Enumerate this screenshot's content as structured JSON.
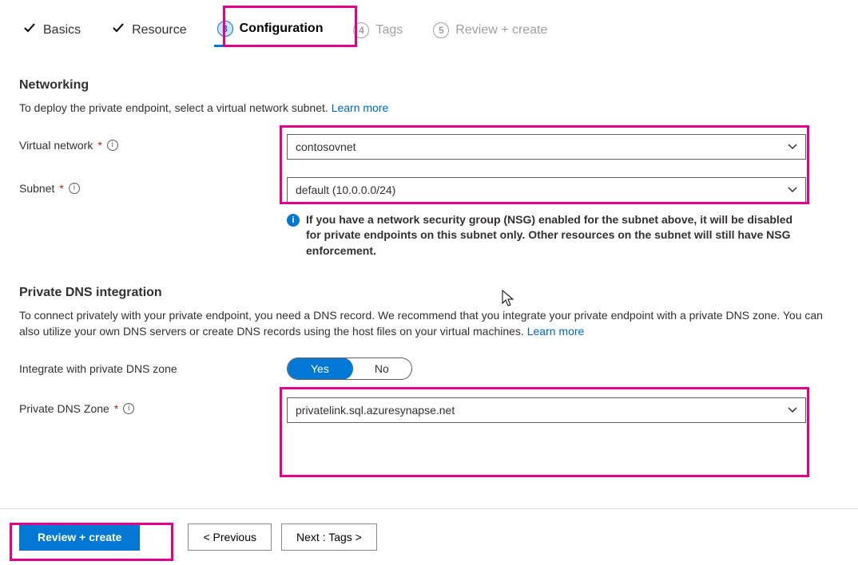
{
  "tabs": {
    "basics": "Basics",
    "resource": "Resource",
    "configuration_num": "3",
    "configuration": "Configuration",
    "tags_num": "4",
    "tags": "Tags",
    "review_num": "5",
    "review": "Review + create"
  },
  "networking": {
    "heading": "Networking",
    "desc": "To deploy the private endpoint, select a virtual network subnet.  ",
    "learn": "Learn more",
    "vnet_label": "Virtual network",
    "vnet_value": "contosovnet",
    "subnet_label": "Subnet",
    "subnet_value": "default (10.0.0.0/24)",
    "hint": "If you have a network security group (NSG) enabled for the subnet above, it will be disabled for private endpoints on this subnet only. Other resources on the subnet will still have NSG enforcement."
  },
  "dns": {
    "heading": "Private DNS integration",
    "desc": "To connect privately with your private endpoint, you need a DNS record. We recommend that you integrate your private endpoint with a private DNS zone. You can also utilize your own DNS servers or create DNS records using the host files on your virtual machines.  ",
    "learn": "Learn more",
    "integrate_label": "Integrate with private DNS zone",
    "yes": "Yes",
    "no": "No",
    "zone_label": "Private DNS Zone",
    "zone_value": "privatelink.sql.azuresynapse.net"
  },
  "footer": {
    "review": "Review + create",
    "previous": "< Previous",
    "next": "Next : Tags >"
  }
}
